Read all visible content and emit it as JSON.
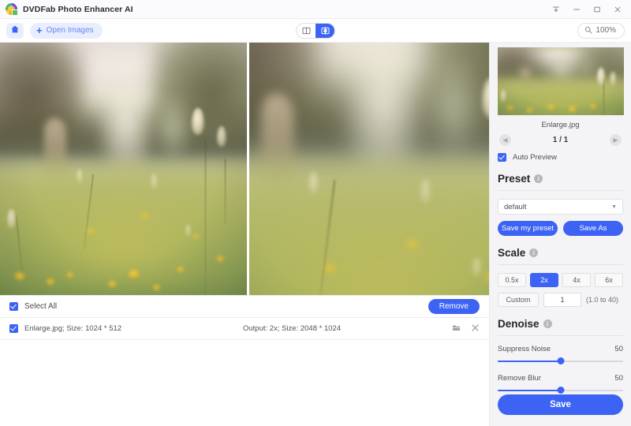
{
  "window": {
    "title": "DVDFab Photo Enhancer AI",
    "logo_icon": "app-logo-icon",
    "controls": [
      {
        "name": "pin-window",
        "icon": "pin-icon"
      },
      {
        "name": "minimize",
        "icon": "minimize-icon"
      },
      {
        "name": "maximize",
        "icon": "maximize-icon"
      },
      {
        "name": "close",
        "icon": "close-icon"
      }
    ]
  },
  "toolbar": {
    "home_icon": "home-icon",
    "open_plus": "+",
    "open_label": "Open Images",
    "view_modes": [
      {
        "name": "single-view",
        "icon": "single-pane-icon",
        "active": false
      },
      {
        "name": "split-view",
        "icon": "split-pane-icon",
        "active": true
      }
    ],
    "zoom_icon": "magnifier-icon",
    "zoom_level": "100%"
  },
  "compare": {
    "left_pane_label": "original-image",
    "right_pane_label": "enhanced-image"
  },
  "filelist": {
    "select_all_label": "Select All",
    "remove_label": "Remove",
    "rows": [
      {
        "name": "Enlarge.jpg; Size: 1024 * 512",
        "output": "Output: 2x; Size: 2048 * 1024",
        "folder_icon": "folder-icon",
        "close_icon": "close-icon"
      }
    ]
  },
  "panel": {
    "preview": {
      "filename": "Enlarge.jpg",
      "page": "1 / 1",
      "prev_icon": "chevron-left-icon",
      "next_icon": "chevron-right-icon",
      "auto_preview_label": "Auto Preview",
      "auto_preview_checked": true
    },
    "preset": {
      "title": "Preset",
      "info_icon": "info-icon",
      "selected": "default",
      "options": [
        "default"
      ],
      "save_my_preset_label": "Save my preset",
      "save_as_label": "Save As"
    },
    "scale": {
      "title": "Scale",
      "info_icon": "info-icon",
      "options": [
        {
          "label": "0.5x",
          "active": false
        },
        {
          "label": "2x",
          "active": true
        },
        {
          "label": "4x",
          "active": false
        },
        {
          "label": "6x",
          "active": false
        }
      ],
      "custom_label": "Custom",
      "custom_value": "1",
      "custom_hint": "(1.0 to 40)"
    },
    "denoise": {
      "title": "Denoise",
      "info_icon": "info-icon",
      "sliders": [
        {
          "label": "Suppress Noise",
          "value": "50",
          "percent": 50
        },
        {
          "label": "Remove Blur",
          "value": "50",
          "percent": 50
        }
      ]
    },
    "save_label": "Save"
  },
  "colors": {
    "accent": "#3d63f5",
    "accent_soft": "#e8eefe",
    "panel_bg": "#f4f4f6",
    "text": "#4d4d55"
  }
}
